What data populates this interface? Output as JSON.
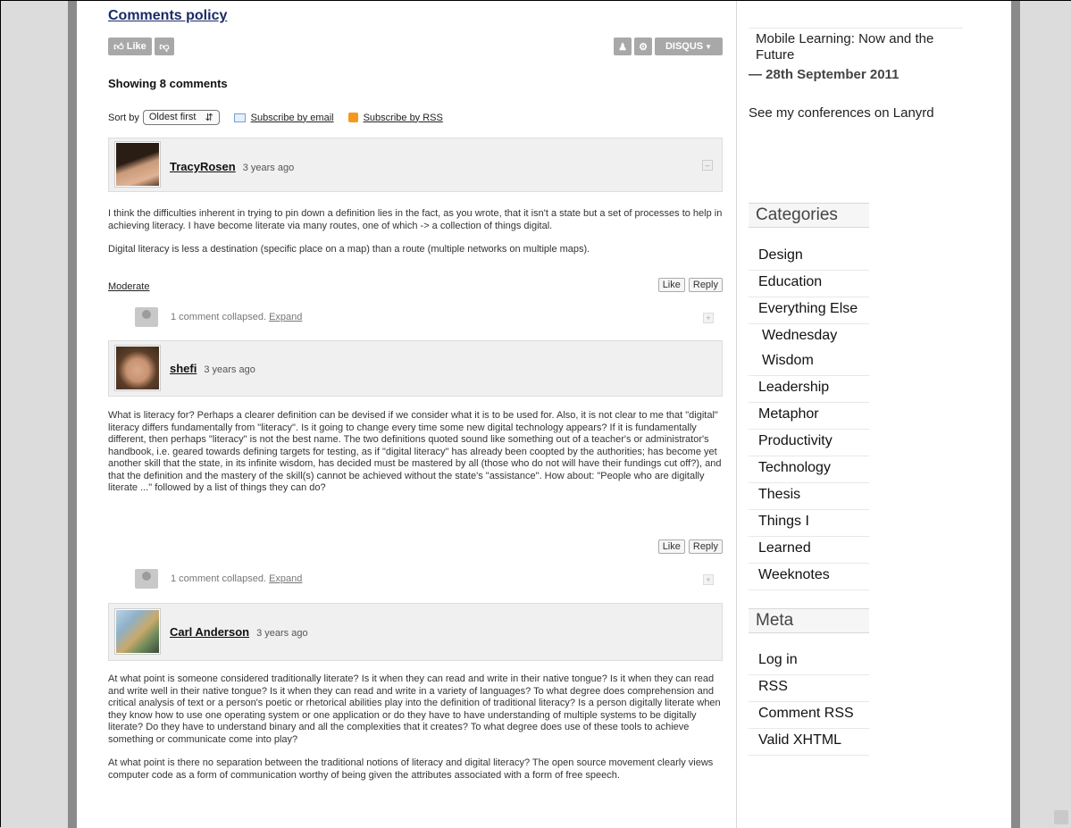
{
  "main": {
    "policy_link": "Comments policy",
    "like_label": "Like",
    "disqus_label": "DISQUS",
    "showing": "Showing 8 comments",
    "sort_label": "Sort by",
    "sort_value": "Oldest first",
    "subscribe_email": "Subscribe by email",
    "subscribe_rss": "Subscribe by RSS",
    "comments": [
      {
        "author": "TracyRosen",
        "time": "3 years ago",
        "p1": "I think the difficulties inherent in trying to pin down a definition lies in the fact, as you wrote, that it isn't a state but a set of processes to help in achieving literacy. I have become literate via many routes, one of which -> a collection of things digital.",
        "p2": "Digital literacy is less a destination (specific place on a map) than a route (multiple networks on multiple maps).",
        "moderate": "Moderate",
        "like": "Like",
        "reply": "Reply",
        "collapsed": "1 comment collapsed.",
        "expand": "Expand"
      },
      {
        "author": "shefi",
        "time": "3 years ago",
        "p1": "What is literacy for? Perhaps a clearer definition can be devised if we consider what it is to be used for. Also, it is not clear to me that \"digital\" literacy differs fundamentally from \"literacy\". Is it going to change every time some new digital technology appears? If it is fundamentally different, then perhaps \"literacy\" is not the best name. The two definitions quoted sound like something out of a teacher's or administrator's handbook, i.e. geared towards defining targets for testing, as if \"digital literacy\" has already been coopted by the authorities; has become yet another skill that the state, in its infinite wisdom, has decided must be mastered by all (those who do not will have their fundings cut off?), and that the definition and the mastery of the skill(s) cannot be achieved without the state's \"assistance\". How about: \"People who are digitally literate ...\" followed by a list of things they can do?",
        "like": "Like",
        "reply": "Reply",
        "collapsed": "1 comment collapsed.",
        "expand": "Expand"
      },
      {
        "author": "Carl Anderson",
        "time": "3 years ago",
        "p1": "At what point is someone considered traditionally literate? Is it when they can read and write in their native tongue? Is it when they can read and write well in their native tongue? Is it when they can read and write in a variety of languages? To what degree does comprehension and critical analysis of text or a person's poetic or rhetorical abilities play into the definition of traditional literacy? Is a person digitally literate when they know how to use one operating system or one application or do they have to have understanding of multiple systems to be digitally literate? Do they have to understand binary and all the complexities that it creates? To what degree does use of these tools to achieve something or communicate come into play?",
        "p2": "At what point is there no separation between the traditional notions of literacy and digital literacy? The open source movement clearly views computer code as a form of communication worthy of being given the attributes associated with a form of free speech."
      }
    ]
  },
  "sidebar": {
    "conference": "Mobile Learning: Now and the Future",
    "date": "— 28th September 2011",
    "lanyrd": "See my conferences on Lanyrd",
    "categories_title": "Categories",
    "categories": [
      "Design",
      "Education",
      "Everything Else",
      "Wednesday",
      "Wisdom",
      "Leadership",
      "Metaphor",
      "Productivity",
      "Technology",
      "Thesis",
      "Things I",
      "Learned",
      "Weeknotes"
    ],
    "meta_title": "Meta",
    "meta": [
      "Log in",
      "RSS",
      "Comment RSS",
      "Valid XHTML"
    ]
  }
}
